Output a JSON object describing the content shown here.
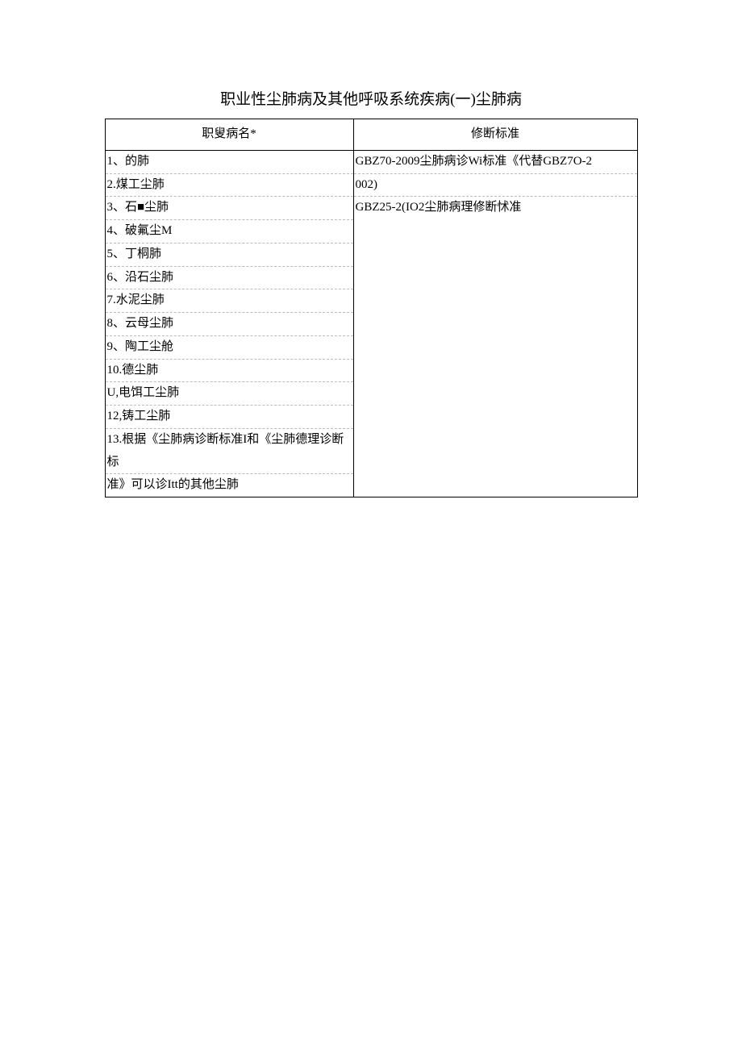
{
  "title": "职业性尘肺病及其他呼吸系统疾病(一)尘肺病",
  "table": {
    "headers": {
      "col1": "职叟病名*",
      "col2": "修断标准"
    },
    "left_lines": [
      "1、的肺",
      "2.煤工尘肺",
      "3、石■尘肺",
      "4、破氟尘M",
      "5、丁桐肺",
      "6、沿石尘肺",
      "7.水泥尘肺",
      "8、云母尘肺",
      "9、陶工尘舱",
      "10.德尘肺",
      "U,电饵工尘肺",
      "12,铸工尘肺",
      "13.根据《尘肺病诊断标准I和《尘肺德理诊断标",
      "准》可以诊Itt的其他尘肺"
    ],
    "right_lines": [
      "GBZ70-2009尘肺病诊Wi标准《代替GBZ7O-2",
      "002)",
      "GBZ25-2(IO2尘肺病理修断怵准"
    ]
  }
}
